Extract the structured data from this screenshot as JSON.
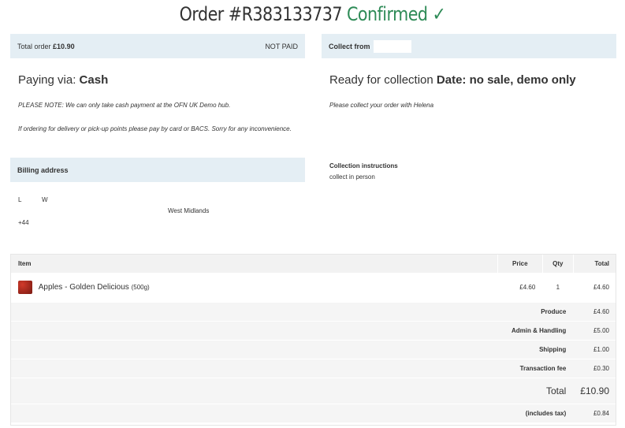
{
  "header": {
    "order_label": "Order #R383133737",
    "status": "Confirmed",
    "check": "✓"
  },
  "summary": {
    "total_label": "Total order",
    "total_value": "£10.90",
    "payment_status": "NOT PAID"
  },
  "collect": {
    "label": "Collect from"
  },
  "payment": {
    "prefix": "Paying via:",
    "method": "Cash",
    "note1": "PLEASE NOTE: We can only take cash payment at the OFN UK Demo hub.",
    "note2": "If ordering for delivery or pick-up points please pay by card or BACS. Sorry for any inconvenience."
  },
  "collection": {
    "prefix": "Ready for collection",
    "date": "Date: no sale, demo only",
    "note": "Please collect your order with Helena",
    "instructions_label": "Collection instructions",
    "instructions_value": "collect in person"
  },
  "billing": {
    "label": "Billing address",
    "line1a": "L",
    "line1b": "W",
    "region": "West Midlands",
    "phone": "+44"
  },
  "table": {
    "headers": {
      "item": "Item",
      "price": "Price",
      "qty": "Qty",
      "total": "Total"
    },
    "item": {
      "name": "Apples - Golden Delicious",
      "unit": "(500g)",
      "price": "£4.60",
      "qty": "1",
      "total": "£4.60"
    },
    "rows": [
      {
        "label": "Produce",
        "value": "£4.60"
      },
      {
        "label": "Admin & Handling",
        "value": "£5.00"
      },
      {
        "label": "Shipping",
        "value": "£1.00"
      },
      {
        "label": "Transaction fee",
        "value": "£0.30"
      }
    ],
    "grand": {
      "label": "Total",
      "value": "£10.90"
    },
    "tax": {
      "label": "(includes tax)",
      "value": "£0.84"
    }
  }
}
